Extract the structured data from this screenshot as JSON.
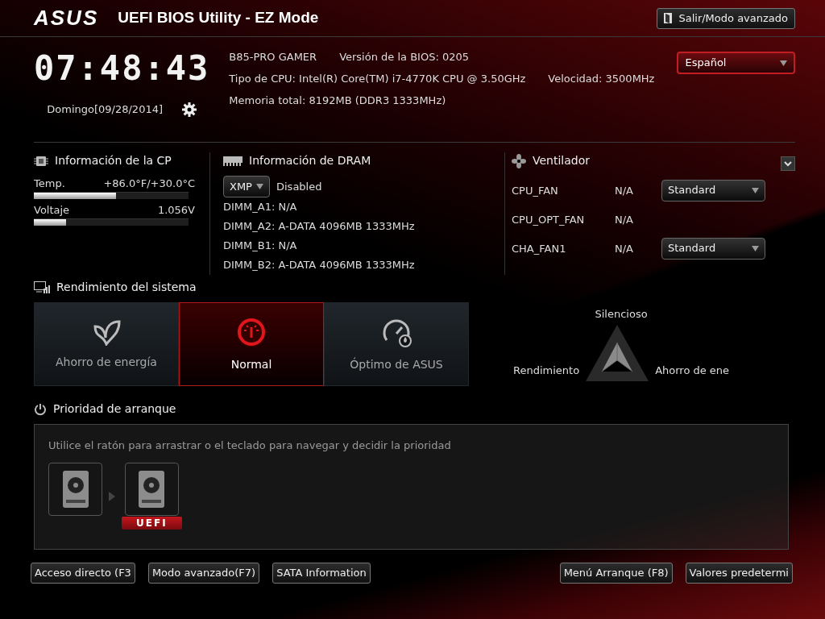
{
  "header": {
    "logo": "ASUS",
    "title": "UEFI BIOS Utility - EZ Mode",
    "exit_button": "Salir/Modo avanzado"
  },
  "clock": {
    "time": "07:48:43",
    "date": "Domingo[09/28/2014]"
  },
  "system_info": [
    {
      "items": [
        "B85-PRO GAMER",
        "Versión de la BIOS: 0205"
      ]
    },
    {
      "items": [
        "Tipo de CPU: Intel(R) Core(TM) i7-4770K CPU @ 3.50GHz",
        "Velocidad: 3500MHz"
      ]
    },
    {
      "items": [
        "Memoria total: 8192MB (DDR3 1333MHz)"
      ]
    }
  ],
  "language": {
    "value": "Español"
  },
  "cpu_info": {
    "title": "Información de la CP",
    "readings": [
      {
        "label": "Temp.",
        "value": "+86.0°F/+30.0°C",
        "level": 0.53
      },
      {
        "label": "Voltaje",
        "value": "1.056V",
        "level": 0.21
      }
    ]
  },
  "dram_info": {
    "title": "Información de DRAM",
    "xmp": {
      "label": "XMP",
      "value": "Disabled"
    },
    "slots": [
      "DIMM_A1: N/A",
      "DIMM_A2: A-DATA 4096MB 1333MHz",
      "DIMM_B1: N/A",
      "DIMM_B2: A-DATA 4096MB 1333MHz"
    ]
  },
  "fan_info": {
    "title": "Ventilador",
    "fans": [
      {
        "name": "CPU_FAN",
        "speed": "N/A",
        "profile": "Standard"
      },
      {
        "name": "CPU_OPT_FAN",
        "speed": "N/A"
      },
      {
        "name": "CHA_FAN1",
        "speed": "N/A",
        "profile": "Standard"
      }
    ]
  },
  "performance": {
    "title": "Rendimiento del sistema",
    "modes": [
      {
        "label": "Ahorro de energía",
        "kind": "leaf",
        "selected": false
      },
      {
        "label": "Normal",
        "kind": "gauge",
        "selected": true
      },
      {
        "label": "Óptimo de ASUS",
        "kind": "turbo",
        "selected": false
      }
    ],
    "triangle": {
      "top": "Silencioso",
      "left": "Rendimiento",
      "right": "Ahorro de ene"
    }
  },
  "boot": {
    "title": "Prioridad de arranque",
    "hint": "Utilice el ratón para arrastrar o el teclado para navegar y decidir la prioridad",
    "devices": [
      {
        "kind": "disk"
      },
      {
        "kind": "disk",
        "badge": "UEFI"
      }
    ]
  },
  "bottom_left_buttons": [
    "Acceso directo (F3",
    "Modo avanzado(F7)",
    "SATA Information"
  ],
  "bottom_right_buttons": [
    "Menú Arranque (F8)",
    "Valores predetermi"
  ]
}
